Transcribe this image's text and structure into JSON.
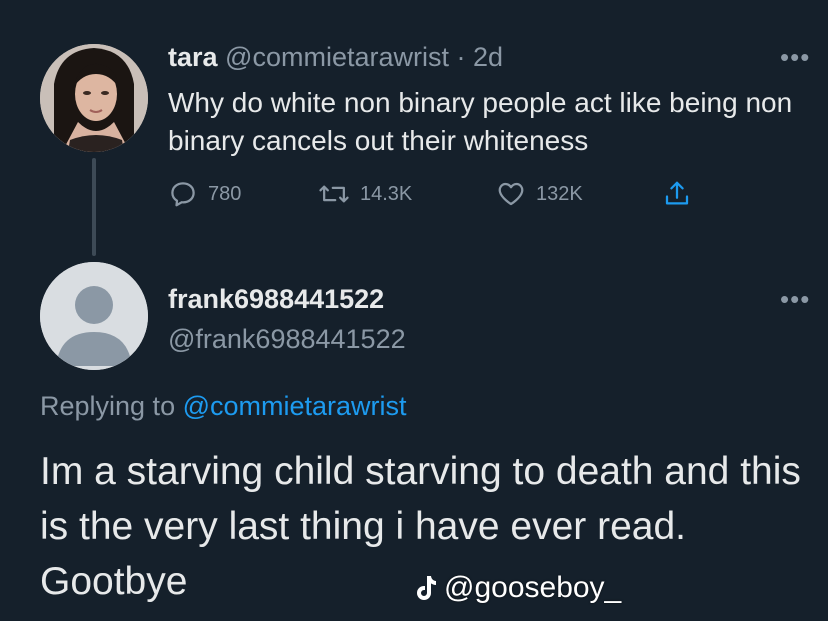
{
  "tweet": {
    "author_name": "tara",
    "author_handle": "@commietarawrist",
    "time": "· 2d",
    "text": "Why do white non binary people act like being non binary cancels out their whiteness",
    "replies": "780",
    "retweets": "14.3K",
    "likes": "132K",
    "more_icon": "more-dots-icon"
  },
  "reply": {
    "author_name": "frank6988441522",
    "author_handle": "@frank6988441522",
    "replying_label": "Replying to",
    "replying_to": "@commietarawrist",
    "text": "Im a starving child starving to death and this is the very last thing i have ever read. Gootbye"
  },
  "watermark": {
    "platform_icon": "tiktok-icon",
    "handle": "@gooseboy_"
  },
  "colors": {
    "background": "#15202b",
    "text": "#e7e9ea",
    "muted": "#8b98a5",
    "link": "#1d9bf0"
  }
}
